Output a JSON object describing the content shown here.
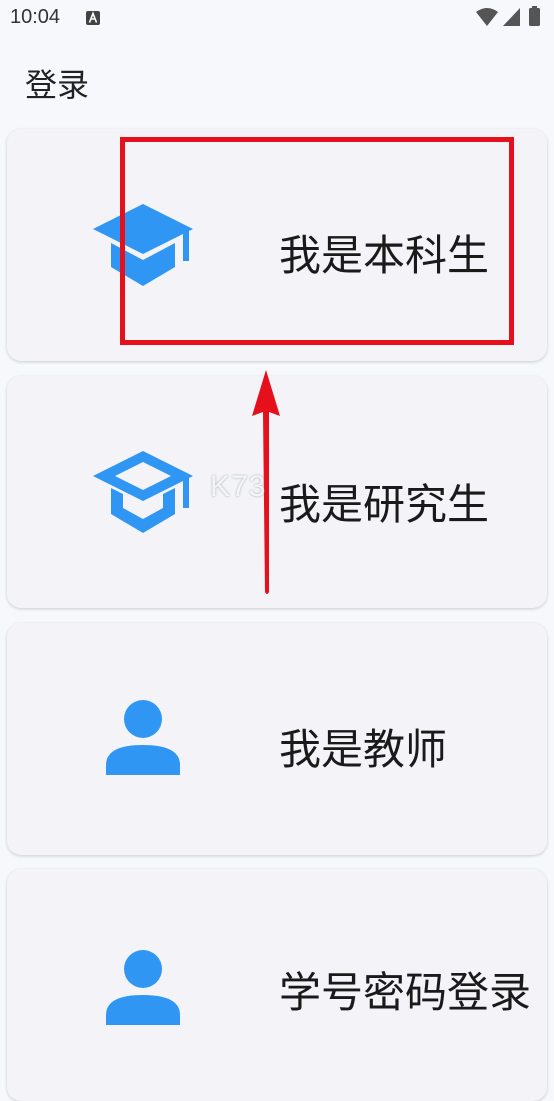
{
  "status_bar": {
    "time": "10:04",
    "icons": [
      "a-notification-icon",
      "wifi-icon",
      "signal-icon",
      "battery-icon"
    ]
  },
  "header": {
    "title": "登录"
  },
  "role_options": [
    {
      "label": "我是本科生",
      "icon": "graduation-cap-icon"
    },
    {
      "label": "我是研究生",
      "icon": "graduation-cap-outline-icon"
    },
    {
      "label": "我是教师",
      "icon": "person-icon"
    },
    {
      "label": "学号密码登录",
      "icon": "person-icon"
    }
  ],
  "overlay": {
    "watermark": "K73"
  },
  "colors": {
    "accent": "#2f96f3",
    "highlight": "#e5101b",
    "background": "#f7f8fc",
    "card": "#f3f3f8"
  }
}
